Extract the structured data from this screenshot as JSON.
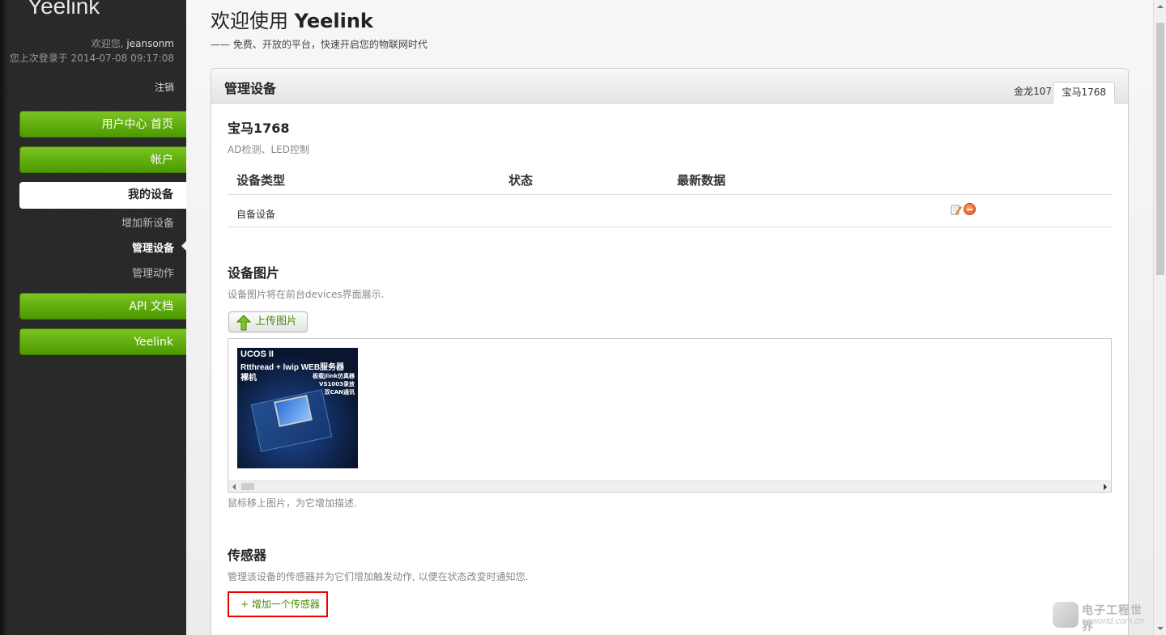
{
  "sidebar": {
    "logo": "Yeelink",
    "welcome_prefix": "欢迎您, ",
    "username": "jeansonm",
    "last_login": "您上次登录于 2014-07-08 09:17:08",
    "logout": "注销",
    "nav": {
      "home": "用户中心 首页",
      "account": "帐户",
      "my_devices": "我的设备",
      "add_device": "增加新设备",
      "manage_device": "管理设备",
      "manage_action": "管理动作",
      "api_docs": "API 文档",
      "yeelink": "Yeelink"
    }
  },
  "header": {
    "title_prefix": "欢迎使用 ",
    "title_brand": "Yeelink",
    "subtitle": "—— 免费、开放的平台，快速开启您的物联网时代"
  },
  "panel": {
    "title": "管理设备",
    "tabs": [
      "金龙107",
      "宝马1768"
    ],
    "device_name": "宝马1768",
    "device_desc": "AD检测、LED控制",
    "table": {
      "headers": [
        "设备类型",
        "状态",
        "最新数据"
      ],
      "rows": [
        {
          "type": "自备设备",
          "status": "",
          "latest": ""
        }
      ]
    },
    "images": {
      "title": "设备图片",
      "desc": "设备图片将在前台devices界面展示.",
      "upload_label": "上传图片",
      "hint": "鼠标移上图片，为它增加描述.",
      "thumb_text": [
        "UCOS II",
        "Rtthread + lwip WEB服务器",
        "裸机",
        "板载jlink仿真器",
        "VS1003录放",
        "双CAN通讯"
      ]
    },
    "sensors": {
      "title": "传感器",
      "desc": "管理该设备的传感器并为它们增加触发动作, 以便在状态改变时通知您.",
      "add_label": "+ 增加一个传感器"
    }
  },
  "watermark": {
    "cn": "电子工程世界",
    "en": "eeworld.com.cn"
  },
  "colors": {
    "nav_green": "#5fae0f",
    "sidebar_bg": "#282828",
    "accent_link": "#4a8a00",
    "highlight_border": "#e00000"
  }
}
